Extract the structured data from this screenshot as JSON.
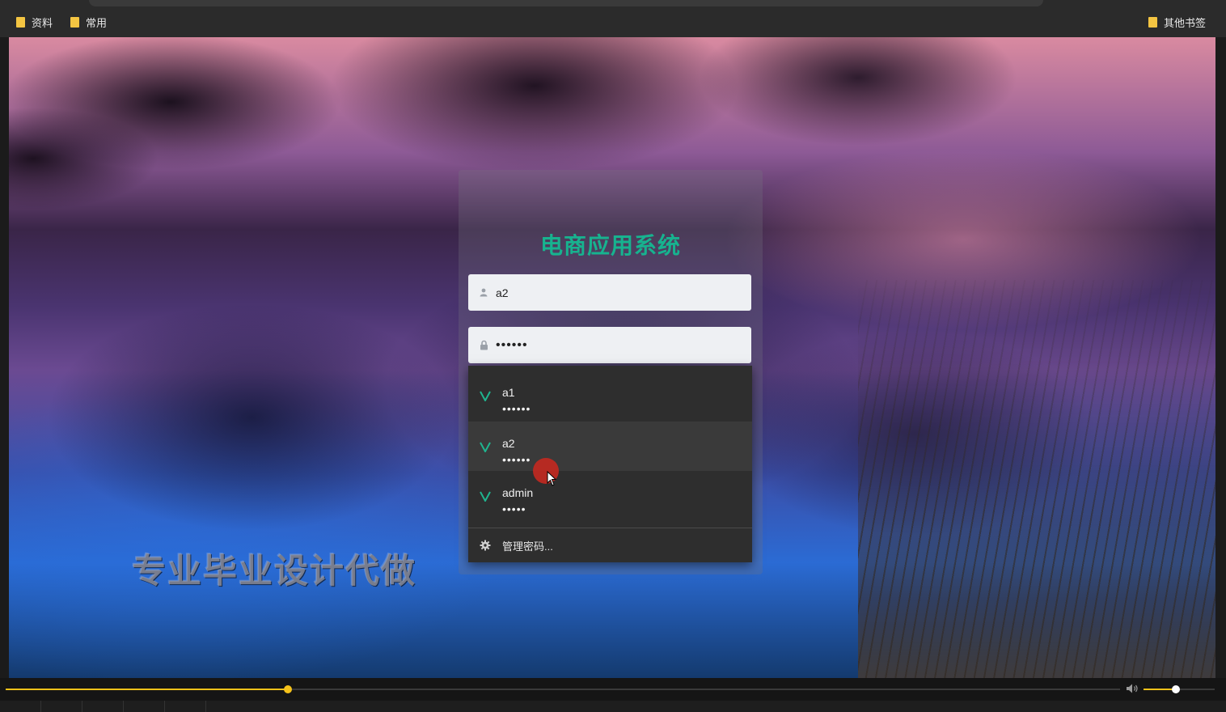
{
  "bookmarks": {
    "items": [
      {
        "label": "资料"
      },
      {
        "label": "常用"
      }
    ],
    "other": "其他书签"
  },
  "watermark": "专业毕业设计代做",
  "login": {
    "title": "电商应用系统",
    "username_value": "a2",
    "password_value": "••••••"
  },
  "autocomplete": {
    "entries": [
      {
        "user": "a1",
        "mask": "••••••"
      },
      {
        "user": "a2",
        "mask": "••••••"
      },
      {
        "user": "admin",
        "mask": "•••••"
      }
    ],
    "hovered_index": 1,
    "manage_label": "管理密码..."
  },
  "player": {
    "progress_fraction": 0.253,
    "volume_fraction": 0.45,
    "accent_color": "#f5c21a"
  },
  "colors": {
    "title_green": "#17b38f",
    "check_green": "#1fb58f"
  },
  "icons": {
    "folder": "folder-icon",
    "user": "user-icon",
    "lock": "lock-icon",
    "check": "check-icon",
    "gear": "gear-icon",
    "volume": "volume-icon"
  }
}
